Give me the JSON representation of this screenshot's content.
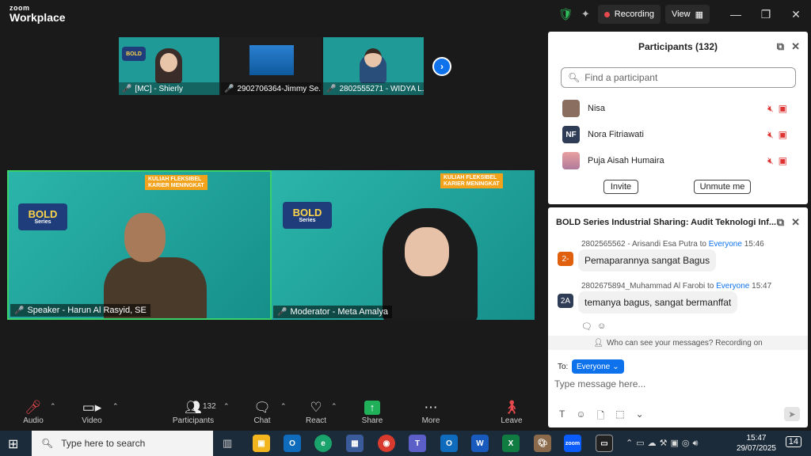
{
  "app": {
    "brand_top": "zoom",
    "brand_bottom": "Workplace"
  },
  "titlebar": {
    "recording": "Recording",
    "view": "View"
  },
  "thumbnails": [
    {
      "label": "[MC] - Shierly"
    },
    {
      "label": "2902706364-Jimmy Se..."
    },
    {
      "label": "2802555271 - WIDYA L..."
    }
  ],
  "tiles": [
    {
      "label": "Speaker - Harun Al Rasyid, SE"
    },
    {
      "label": "Moderator - Meta Amalya"
    }
  ],
  "participants": {
    "title": "Participants (132)",
    "search_placeholder": "Find a participant",
    "list": [
      {
        "name": "Nisa",
        "initials": ""
      },
      {
        "name": "Nora Fitriawati",
        "initials": "NF"
      },
      {
        "name": "Puja Aisah Humaira",
        "initials": ""
      }
    ],
    "invite": "Invite",
    "unmute": "Unmute me"
  },
  "chat": {
    "title": "BOLD Series Industrial Sharing: Audit Teknologi Inf...",
    "messages": [
      {
        "sender": "2802565562 - Arisandi Esa Putra",
        "to_word": "to",
        "to": "Everyone",
        "time": "15:46",
        "text": "Pemaparannya sangat Bagus",
        "initials": "2-"
      },
      {
        "sender": "2802675894_Muhammad Al Farobi",
        "to_word": "to",
        "to": "Everyone",
        "time": "15:47",
        "text": "temanya bagus, sangat bermanffat",
        "initials": "2A"
      }
    ],
    "privacy": "Who can see your messages? Recording on",
    "to_label": "To:",
    "to_value": "Everyone",
    "placeholder": "Type message here..."
  },
  "toolbar": {
    "audio": "Audio",
    "video": "Video",
    "participants": "Participants",
    "participants_count": "132",
    "chat": "Chat",
    "react": "React",
    "share": "Share",
    "more": "More",
    "leave": "Leave"
  },
  "taskbar": {
    "search": "Type here to search",
    "time": "15:47",
    "date": "29/07/2025",
    "notif": "14"
  }
}
